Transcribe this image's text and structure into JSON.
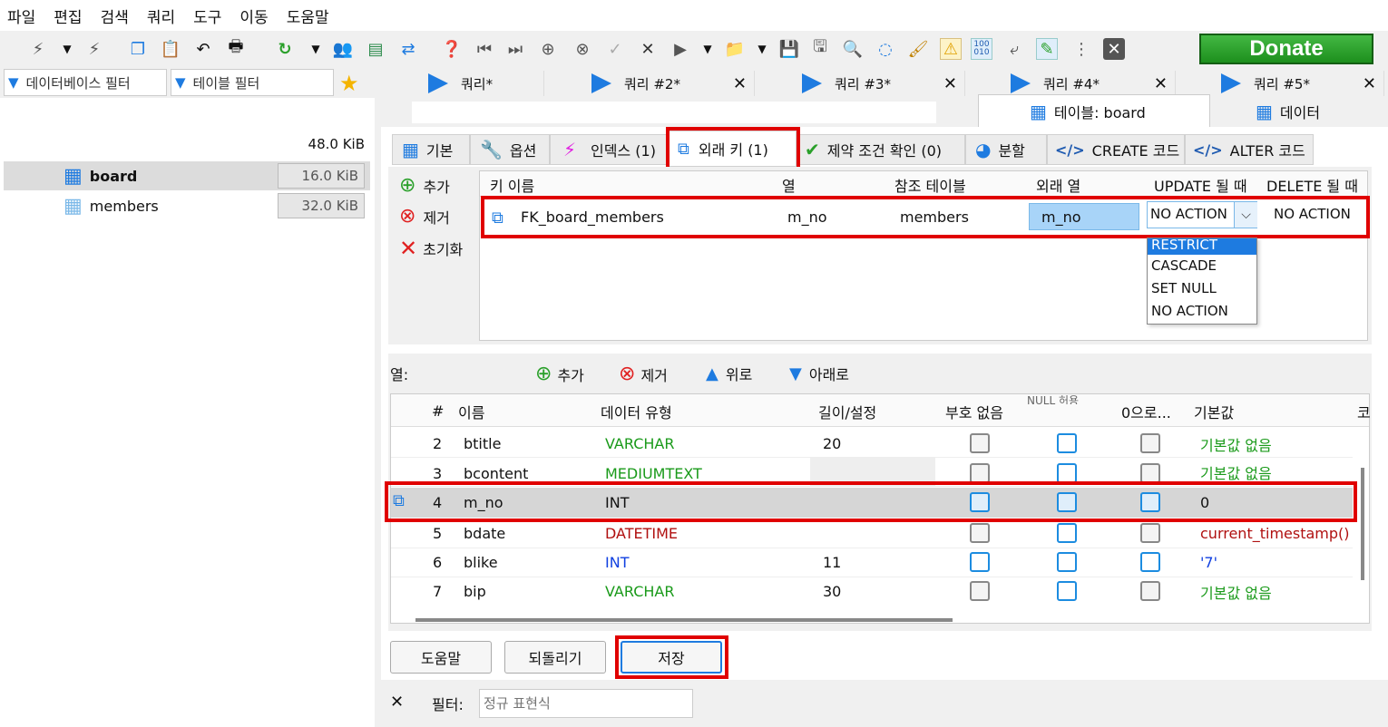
{
  "menu": [
    "파일",
    "편집",
    "검색",
    "쿼리",
    "도구",
    "이동",
    "도움말"
  ],
  "donate_label": "Donate",
  "filters": {
    "db_filter": "데이터베이스 필터",
    "table_filter": "테이블 필터"
  },
  "tree": {
    "total_size": "48.0 KiB",
    "items": [
      {
        "name": "board",
        "size": "16.0 KiB"
      },
      {
        "name": "members",
        "size": "32.0 KiB"
      }
    ]
  },
  "query_tabs": [
    "쿼리*",
    "쿼리 #2*",
    "쿼리 #3*",
    "쿼리 #4*",
    "쿼리 #5*"
  ],
  "editor_tabs": {
    "table": "테이블: board",
    "data": "데이터"
  },
  "sub_tabs": [
    "기본",
    "옵션",
    "인덱스 (1)",
    "외래 키 (1)",
    "제약 조건 확인 (0)",
    "분할",
    "CREATE 코드",
    "ALTER 코드"
  ],
  "fk_actions": {
    "add": "추가",
    "remove": "제거",
    "clear": "초기화"
  },
  "fk_headers": [
    "키 이름",
    "열",
    "참조 테이블",
    "외래 열",
    "UPDATE 될 때",
    "DELETE 될 때"
  ],
  "fk_row": {
    "name": "FK_board_members",
    "column": "m_no",
    "ref_table": "members",
    "foreign_col": "m_no",
    "on_update": "NO ACTION",
    "on_delete": "NO ACTION"
  },
  "dropdown_options": [
    "RESTRICT",
    "CASCADE",
    "SET NULL",
    "NO ACTION"
  ],
  "columns_label": "열:",
  "col_actions": {
    "add": "추가",
    "remove": "제거",
    "up": "위로",
    "down": "아래로"
  },
  "col_headers": [
    "#",
    "이름",
    "데이터 유형",
    "길이/설정",
    "부호 없음",
    "NULL 허용",
    "0으로...",
    "기본값",
    "코"
  ],
  "col_rows": [
    {
      "num": "2",
      "name": "btitle",
      "type": "VARCHAR",
      "length": "20",
      "default": "기본값 없음"
    },
    {
      "num": "3",
      "name": "bcontent",
      "type": "MEDIUMTEXT",
      "length": "",
      "default": "기본값 없음"
    },
    {
      "num": "4",
      "name": "m_no",
      "type": "INT",
      "length": "",
      "default": "0"
    },
    {
      "num": "5",
      "name": "bdate",
      "type": "DATETIME",
      "length": "",
      "default": "current_timestamp()"
    },
    {
      "num": "6",
      "name": "blike",
      "type": "INT",
      "length": "11",
      "default": "'7'"
    },
    {
      "num": "7",
      "name": "bip",
      "type": "VARCHAR",
      "length": "30",
      "default": "기본값 없음"
    }
  ],
  "buttons": {
    "help": "도움말",
    "revert": "되돌리기",
    "save": "저장"
  },
  "filter_bar": {
    "label": "필터:",
    "placeholder": "정규 표현식"
  },
  "colors": {
    "accent": "#1e7be0",
    "highlight_red": "#e00000",
    "varchar_green": "#1a9a1a",
    "int_blue": "#1040e0",
    "datetime_red": "#b01010"
  }
}
